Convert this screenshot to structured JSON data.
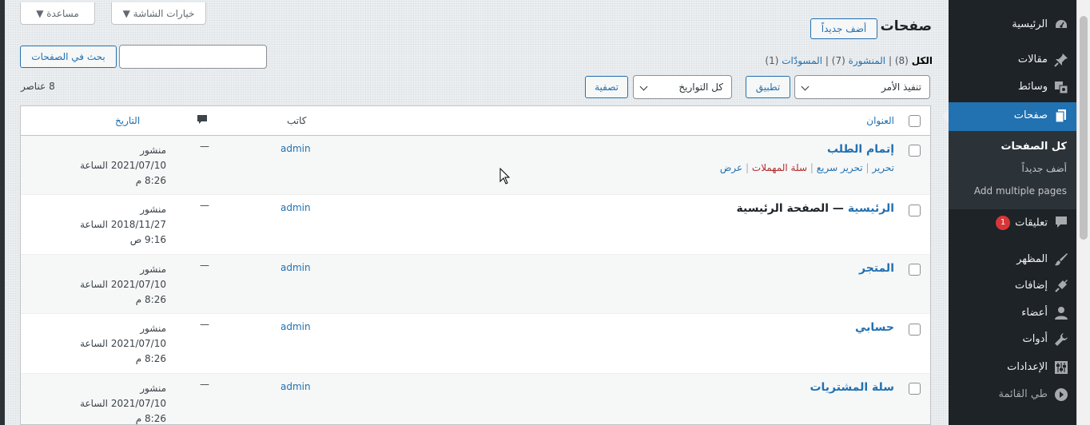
{
  "screen_tabs": {
    "screen_options": "خيارات الشاشة ▼",
    "help": "مساعدة ▼"
  },
  "menu": {
    "dashboard": "الرئيسية",
    "posts": "مقالات",
    "media": "وسائط",
    "pages": "صفحات",
    "pages_sub": {
      "all": "كل الصفحات",
      "add_new": "أضف جديداً",
      "add_multiple": "Add multiple pages"
    },
    "comments": "تعليقات",
    "comments_badge": "1",
    "appearance": "المظهر",
    "plugins": "إضافات",
    "users": "أعضاء",
    "tools": "أدوات",
    "settings": "الإعدادات",
    "collapse": "طي القائمة"
  },
  "header": {
    "title": "صفحات",
    "add_new": "أضف جديداً"
  },
  "search": {
    "button": "بحث في الصفحات",
    "value": ""
  },
  "views": {
    "all_label": "الكل",
    "all_count": "(8)",
    "published_label": "المنشورة",
    "published_count": "(7)",
    "drafts_label": "المسودّات",
    "drafts_count": "(1)",
    "sep": "|"
  },
  "bulk": {
    "action": "تنفيذ الأمر",
    "apply": "تطبيق",
    "dates": "كل التواريخ",
    "filter": "تصفية",
    "items_count": "8 عناصر"
  },
  "table": {
    "headers": {
      "title": "العنوان",
      "author": "كاتب",
      "date": "التاريخ"
    },
    "rows": [
      {
        "title": "إتمام الطلب",
        "state": "",
        "author": "admin",
        "comments": "—",
        "status": "منشور",
        "date": "2021/07/10 الساعة",
        "time": "8:26 م"
      },
      {
        "title": "الرئيسية",
        "state": " — الصفحة الرئيسية",
        "author": "admin",
        "comments": "—",
        "status": "منشور",
        "date": "2018/11/27 الساعة",
        "time": "9:16 ص"
      },
      {
        "title": "المتجر",
        "state": "",
        "author": "admin",
        "comments": "—",
        "status": "منشور",
        "date": "2021/07/10 الساعة",
        "time": "8:26 م"
      },
      {
        "title": "حسابي",
        "state": "",
        "author": "admin",
        "comments": "—",
        "status": "منشور",
        "date": "2021/07/10 الساعة",
        "time": "8:26 م"
      },
      {
        "title": "سلة المشتريات",
        "state": "",
        "author": "admin",
        "comments": "—",
        "status": "منشور",
        "date": "2021/07/10 الساعة",
        "time": "8:26 م"
      }
    ],
    "row_actions": {
      "edit": "تحرير",
      "quick_edit": "تحرير سريع",
      "trash": "سلة المهملات",
      "view": "عرض",
      "sep": "|"
    }
  },
  "colors": {
    "menu_bg": "#1d2327",
    "accent": "#2271b1",
    "danger": "#d63638"
  }
}
